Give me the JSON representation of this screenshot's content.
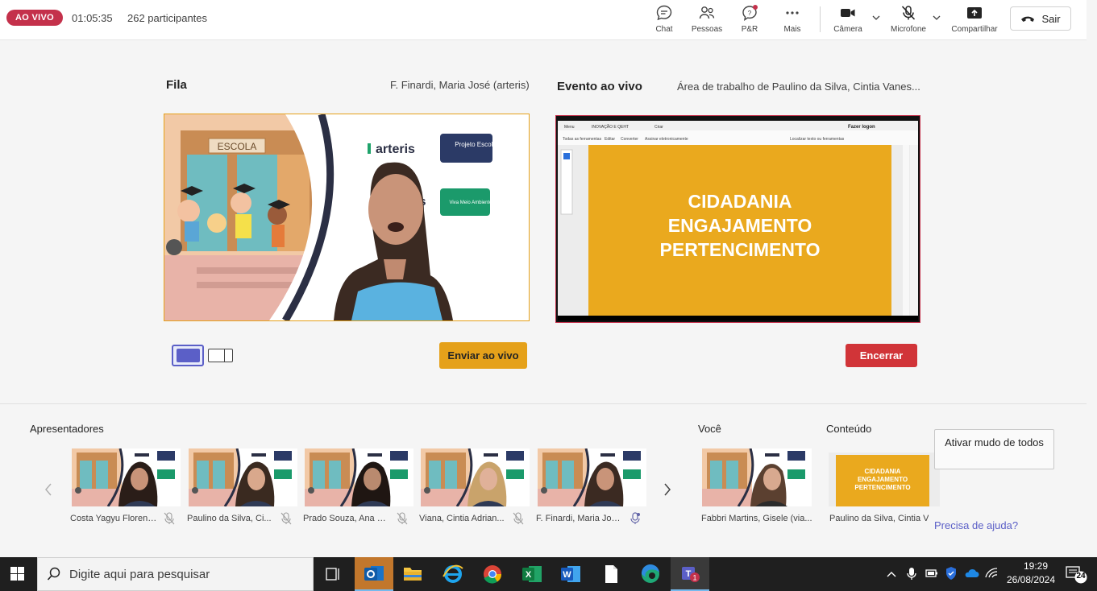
{
  "topbar": {
    "live_badge": "AO VIVO",
    "timer": "01:05:35",
    "participants": "262 participantes",
    "buttons": {
      "chat": "Chat",
      "people": "Pessoas",
      "qa": "P&R",
      "more": "Mais",
      "camera": "Câmera",
      "mic": "Microfone",
      "share": "Compartilhar"
    },
    "leave": "Sair"
  },
  "queue": {
    "title": "Fila",
    "presenter": "F. Finardi, Maria José (arteris)",
    "slide": {
      "school_sign": "ESCOLA",
      "brand": "arteris",
      "project_badge": "Projeto Escola",
      "env_badge": "Viva Meio Ambiente",
      "brand_fragment": "is"
    },
    "send_button": "Enviar ao vivo"
  },
  "live": {
    "title": "Evento ao vivo",
    "presenter": "Área de trabalho de Paulino da Silva, Cintia Vanes...",
    "slide_lines": [
      "CIDADANIA",
      "ENGAJAMENTO",
      "PERTENCIMENTO"
    ],
    "viewer_menu": [
      "Menu",
      "INOVAÇÃO E QEHT",
      "Criar"
    ],
    "viewer_toolbar": [
      "Todas as ferramentas",
      "Editar",
      "Converter",
      "Assinar eletronicamente"
    ],
    "viewer_search": "Localizar texto ou ferramentas",
    "viewer_login": "Fazer logon",
    "end_button": "Encerrar"
  },
  "presenters": {
    "title": "Apresentadores",
    "items": [
      {
        "name": "Costa Yagyu Florence..."
      },
      {
        "name": "Paulino da Silva, Ci..."
      },
      {
        "name": "Prado Souza, Ana C..."
      },
      {
        "name": "Viana, Cintia Adrian..."
      },
      {
        "name": "F. Finardi, Maria Jos..."
      }
    ]
  },
  "you": {
    "title": "Você",
    "name": "Fabbri Martins, Gisele (via..."
  },
  "content": {
    "title": "Conteúdo",
    "name": "Paulino da Silva, Cintia V...",
    "slide_lines": [
      "CIDADANIA",
      "ENGAJAMENTO",
      "PERTENCIMENTO"
    ]
  },
  "side": {
    "mute_all": "Ativar mudo de todos",
    "help": "Precisa de ajuda?"
  },
  "taskbar": {
    "search_placeholder": "Digite aqui para pesquisar",
    "time": "19:29",
    "date": "26/08/2024",
    "notifications": "24",
    "teams_badge": "1"
  },
  "colors": {
    "live_red": "#c4314b",
    "queue_amber": "#e5a11a",
    "brand_purple": "#5b5fc7",
    "slide_yellow": "#eaa91e",
    "end_red": "#d13438"
  }
}
